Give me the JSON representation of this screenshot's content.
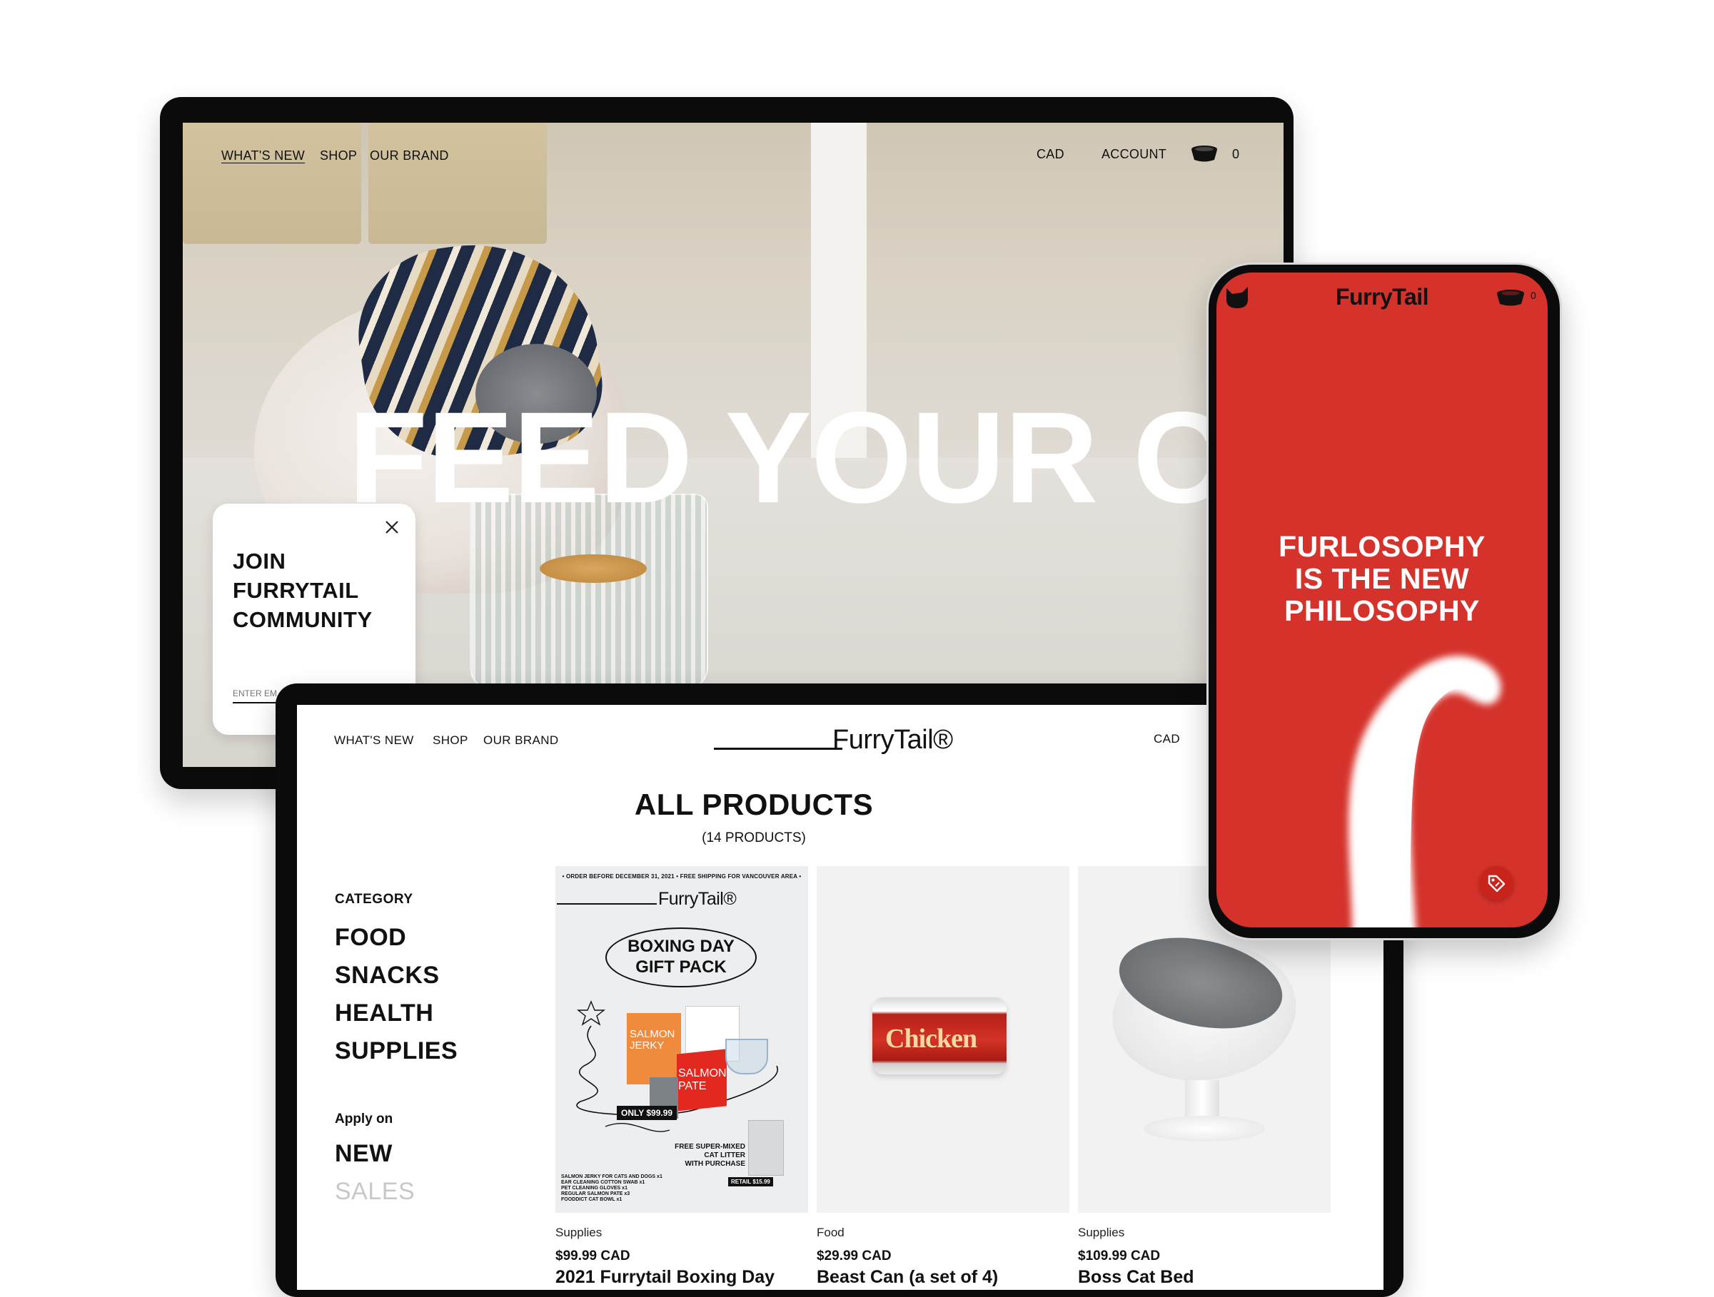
{
  "hero_site": {
    "nav": [
      "WHAT'S NEW",
      "SHOP",
      "OUR BRAND"
    ],
    "right_nav": {
      "currency": "CAD",
      "account": "ACCOUNT",
      "cart_count": "0"
    },
    "headline": "FEED YOUR CA",
    "popup": {
      "title_lines": [
        "JOIN",
        "FURRYTAIL",
        "COMMUNITY"
      ],
      "email_placeholder": "ENTER EM"
    }
  },
  "shop_site": {
    "nav": [
      "WHAT'S NEW",
      "SHOP",
      "OUR BRAND"
    ],
    "logo": "FurryTail®",
    "currency": "CAD",
    "title": "ALL PRODUCTS",
    "subtitle": "(14 PRODUCTS)",
    "filters": {
      "category_label": "CATEGORY",
      "categories": [
        "FOOD",
        "SNACKS",
        "HEALTH",
        "SUPPLIES"
      ],
      "apply_label": "Apply on",
      "apply_options": [
        "NEW",
        "SALES"
      ]
    },
    "gift_card": {
      "banner": "• ORDER BEFORE DECEMBER 31, 2021 • FREE SHIPPING FOR VANCOUVER AREA •",
      "logo": "FurryTail®",
      "badge_lines": [
        "BOXING DAY",
        "GIFT PACK"
      ],
      "box1": "SALMON JERKY",
      "box2": "SALMON PATE",
      "price_tag": "ONLY $99.99",
      "free_lines": [
        "FREE SUPER-MIXED",
        "CAT LITTER",
        "WITH PURCHASE"
      ],
      "retail_tag": "RETAIL $15.99",
      "contents": [
        "SALMON JERKY FOR CATS AND DOGS x1",
        "EAR CLEANING COTTON SWAB x1",
        "PET CLEANING GLOVES x1",
        "REGULAR SALMON PATE x3",
        "FOODDICT CAT BOWL x1"
      ]
    },
    "can_label": "Chicken",
    "products": [
      {
        "category": "Supplies",
        "price": "$99.99 CAD",
        "name": "2021 Furrytail Boxing Day"
      },
      {
        "category": "Food",
        "price": "$29.99 CAD",
        "name": "Beast Can (a set of 4)"
      },
      {
        "category": "Supplies",
        "price": "$109.99 CAD",
        "name": "Boss Cat Bed"
      }
    ]
  },
  "phone": {
    "logo": "FurryTail",
    "cart_count": "0",
    "headline_lines": [
      "FURLOSOPHY",
      "IS THE NEW",
      "PHILOSOPHY"
    ]
  },
  "colors": {
    "brand_red": "#d4322a",
    "device_frame": "#0b0b0b",
    "sales_inactive": "#c8c8c8"
  }
}
